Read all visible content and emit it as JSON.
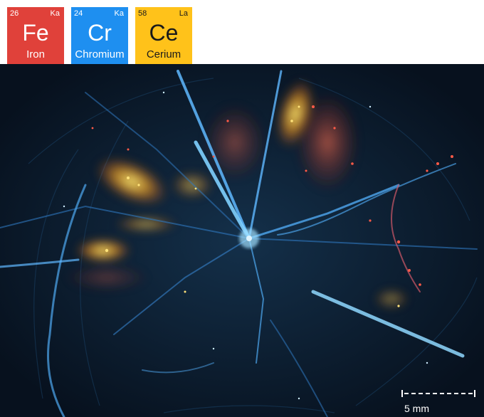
{
  "legend": {
    "elements": [
      {
        "number": "26",
        "line": "Ka",
        "symbol": "Fe",
        "name": "Iron",
        "color": "#e0413a"
      },
      {
        "number": "24",
        "line": "Ka",
        "symbol": "Cr",
        "name": "Chromium",
        "color": "#1e8ff0"
      },
      {
        "number": "58",
        "line": "La",
        "symbol": "Ce",
        "name": "Cerium",
        "color": "#ffc21a"
      }
    ]
  },
  "scalebar": {
    "label": "5 mm"
  }
}
